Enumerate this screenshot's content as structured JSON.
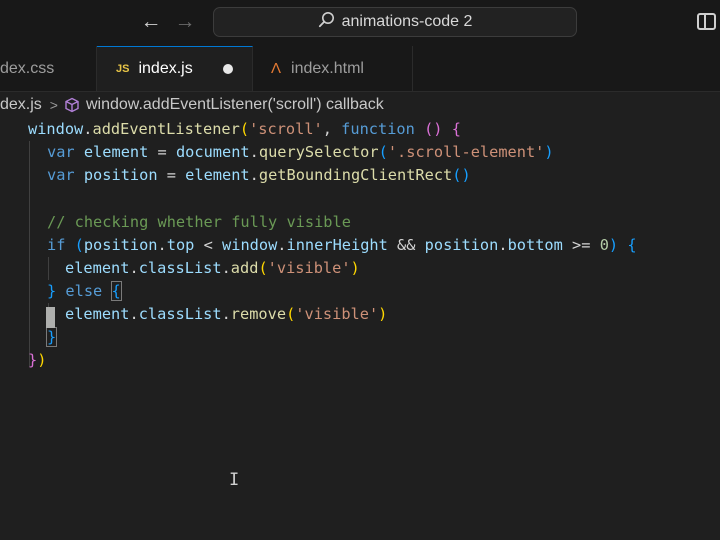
{
  "titlebar": {
    "back_icon": "arrow-left-icon",
    "forward_icon": "arrow-right-icon",
    "search_icon": "search-icon",
    "search_text": "animations-code 2",
    "layout_icon": "sidebar-toggle-icon"
  },
  "tabs": [
    {
      "label": "dex.css",
      "active": false
    },
    {
      "label": "index.js",
      "badge": "JS",
      "active": true,
      "dirty": true
    },
    {
      "label": "index.html",
      "icon": "html-file-icon",
      "active": false
    }
  ],
  "breadcrumb": {
    "file": "dex.js",
    "separator": ">",
    "symbol_icon": "method-cube-icon",
    "symbol": "window.addEventListener('scroll') callback"
  },
  "code": {
    "line1": {
      "obj": "window",
      "dot": ".",
      "method": "addEventListener",
      "open": "(",
      "arg": "'scroll'",
      "comma": ", ",
      "kw": "function",
      "sp": " ",
      "params": "()",
      "brace": " {"
    },
    "line2": {
      "kw": "var",
      "name": " element",
      "eq": " = ",
      "obj": "document",
      "dot": ".",
      "method": "querySelector",
      "open": "(",
      "arg": "'.scroll-element'",
      "close": ")"
    },
    "line3": {
      "kw": "var",
      "name": " position",
      "eq": " = ",
      "obj": "element",
      "dot": ".",
      "method": "getBoundingClientRect",
      "parens": "()"
    },
    "line5": {
      "comment": "// checking whether fully visible"
    },
    "line6": {
      "kw": "if",
      "open": " (",
      "a": "position",
      "dot1": ".",
      "b": "top",
      "lt": " < ",
      "c": "window",
      "dot2": ".",
      "d": "innerHeight",
      "and": " && ",
      "e": "position",
      "dot3": ".",
      "f": "bottom",
      "ge": " >= ",
      "zero": "0",
      "close": ")",
      "brace": " {"
    },
    "line7": {
      "obj": "element",
      "dot1": ".",
      "prop": "classList",
      "dot2": ".",
      "method": "add",
      "open": "(",
      "arg": "'visible'",
      "close": ")"
    },
    "line8": {
      "close": "}",
      "kw": " else",
      "sp": " ",
      "open": "{"
    },
    "line9": {
      "obj": "element",
      "dot1": ".",
      "prop": "classList",
      "dot2": ".",
      "method": "remove",
      "open": "(",
      "arg": "'visible'",
      "close": ")"
    },
    "line10": {
      "close": "}"
    },
    "line11": {
      "brace": "}",
      "paren": ")"
    }
  },
  "cursor_icon": "text-cursor-ibeam-icon",
  "mouse_glyph": "I"
}
